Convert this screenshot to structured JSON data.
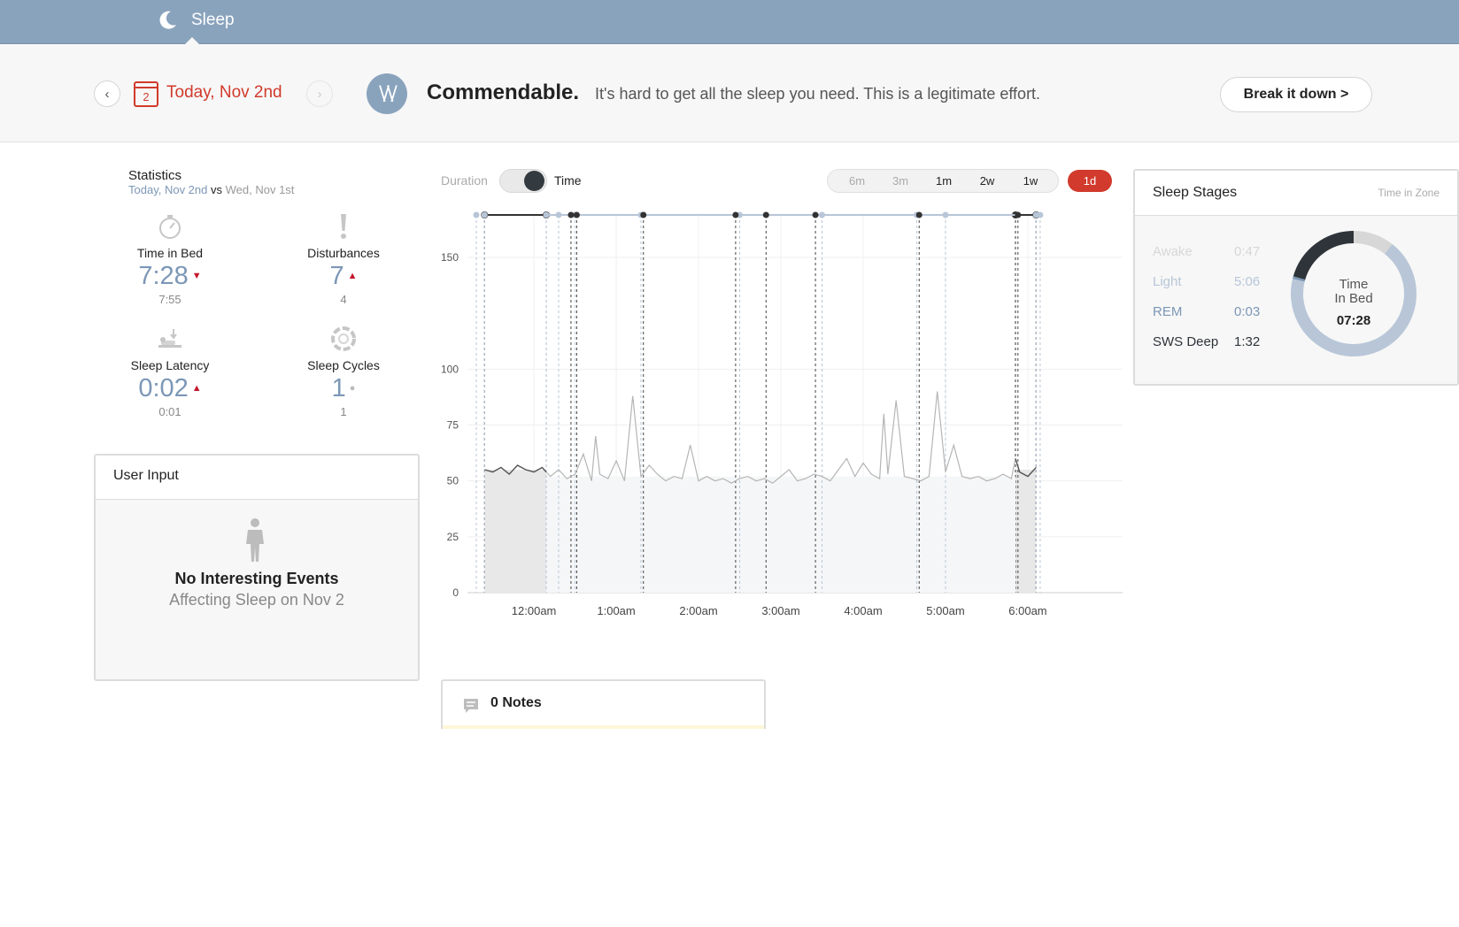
{
  "app": {
    "title": "Sleep",
    "icon": "moon-icon"
  },
  "header": {
    "prev_icon": "chevron-left-icon",
    "next_icon": "chevron-right-icon",
    "calendar_day": "2",
    "date_label": "Today, Nov 2nd",
    "score_logo": "\\/\\/",
    "verdict": "Commendable.",
    "verdict_text": "It's hard to get all the sleep you need. This is a legitimate effort.",
    "breakdown_label": "Break it down >"
  },
  "statistics": {
    "title": "Statistics",
    "current_date": "Today, Nov 2nd",
    "vs": "vs",
    "compare_date": "Wed, Nov 1st",
    "items": [
      {
        "label": "Time in Bed",
        "value": "7:28",
        "trend": "down",
        "previous": "7:55",
        "icon": "stopwatch-icon"
      },
      {
        "label": "Disturbances",
        "value": "7",
        "trend": "up",
        "previous": "4",
        "icon": "exclamation-icon"
      },
      {
        "label": "Sleep Latency",
        "value": "0:02",
        "trend": "up",
        "previous": "0:01",
        "icon": "bed-icon"
      },
      {
        "label": "Sleep Cycles",
        "value": "1",
        "trend": "same",
        "previous": "1",
        "icon": "cycle-icon"
      }
    ]
  },
  "user_input": {
    "title": "User Input",
    "icon": "person-icon",
    "line1": "No Interesting Events",
    "line2": "Affecting Sleep on Nov 2"
  },
  "chart_controls": {
    "toggle_left": "Duration",
    "toggle_right": "Time",
    "toggle_state": "Time",
    "ranges": [
      "6m",
      "3m",
      "1m",
      "2w",
      "1w",
      "1d"
    ],
    "active_range": "1d"
  },
  "chart_data": {
    "type": "area",
    "x_type": "time",
    "x_ticks": [
      "12:00am",
      "1:00am",
      "2:00am",
      "3:00am",
      "4:00am",
      "5:00am",
      "6:00am"
    ],
    "y_ticks": [
      0,
      25,
      50,
      75,
      100,
      150
    ],
    "ylim": [
      0,
      170
    ],
    "xlim_hours": [
      -0.7,
      6.85
    ],
    "grid": true,
    "deep_sleep_periods": [
      [
        -0.6,
        0.15
      ],
      [
        5.85,
        6.1
      ]
    ],
    "awake_markers": [
      [
        -0.7,
        -0.6
      ],
      [
        0.15,
        0.3
      ],
      [
        0.5,
        1.3
      ],
      [
        2.5,
        3.5
      ],
      [
        4.65,
        5.0
      ],
      [
        6.1,
        6.15
      ]
    ],
    "series": [
      {
        "x": [
          -0.6,
          -0.5,
          -0.4,
          -0.3,
          -0.2,
          -0.1,
          0.0,
          0.1,
          0.15,
          0.2,
          0.3,
          0.4,
          0.5,
          0.6,
          0.7,
          0.75,
          0.8,
          0.9,
          1.0,
          1.1,
          1.2,
          1.3,
          1.4,
          1.5,
          1.6,
          1.7,
          1.8,
          1.9,
          2.0,
          2.1,
          2.2,
          2.3,
          2.4,
          2.5,
          2.6,
          2.7,
          2.8,
          2.9,
          3.0,
          3.1,
          3.2,
          3.3,
          3.4,
          3.5,
          3.6,
          3.7,
          3.8,
          3.9,
          4.0,
          4.1,
          4.2,
          4.25,
          4.3,
          4.4,
          4.5,
          4.6,
          4.7,
          4.8,
          4.9,
          5.0,
          5.1,
          5.2,
          5.3,
          5.4,
          5.5,
          5.6,
          5.7,
          5.8,
          5.85,
          5.9,
          6.0,
          6.1
        ],
        "y": [
          55,
          54,
          56,
          53,
          57,
          55,
          54,
          56,
          54,
          52,
          55,
          51,
          53,
          62,
          50,
          70,
          53,
          51,
          59,
          50,
          88,
          52,
          57,
          53,
          50,
          52,
          51,
          66,
          50,
          52,
          50,
          51,
          49,
          51,
          52,
          50,
          51,
          49,
          52,
          55,
          50,
          51,
          53,
          52,
          50,
          55,
          60,
          52,
          58,
          53,
          51,
          80,
          53,
          86,
          52,
          51,
          50,
          52,
          90,
          54,
          66,
          52,
          51,
          52,
          50,
          51,
          53,
          51,
          60,
          54,
          52,
          56
        ]
      }
    ]
  },
  "notes": {
    "icon": "comment-icon",
    "label": "0 Notes"
  },
  "sleep_stages": {
    "title": "Sleep Stages",
    "subtitle": "Time in Zone",
    "rows": [
      {
        "name": "Awake",
        "value": "0:47",
        "color": "#d7d7d7"
      },
      {
        "name": "Light",
        "value": "5:06",
        "color": "#b8c6d8"
      },
      {
        "name": "REM",
        "value": "0:03",
        "color": "#7c97b6"
      },
      {
        "name": "SWS Deep",
        "value": "1:32",
        "color": "#2e343a"
      }
    ],
    "donut_label_1": "Time",
    "donut_label_2": "In Bed",
    "donut_value": "07:28",
    "donut_minutes": {
      "awake": 47,
      "light": 306,
      "rem": 3,
      "deep": 92
    }
  }
}
